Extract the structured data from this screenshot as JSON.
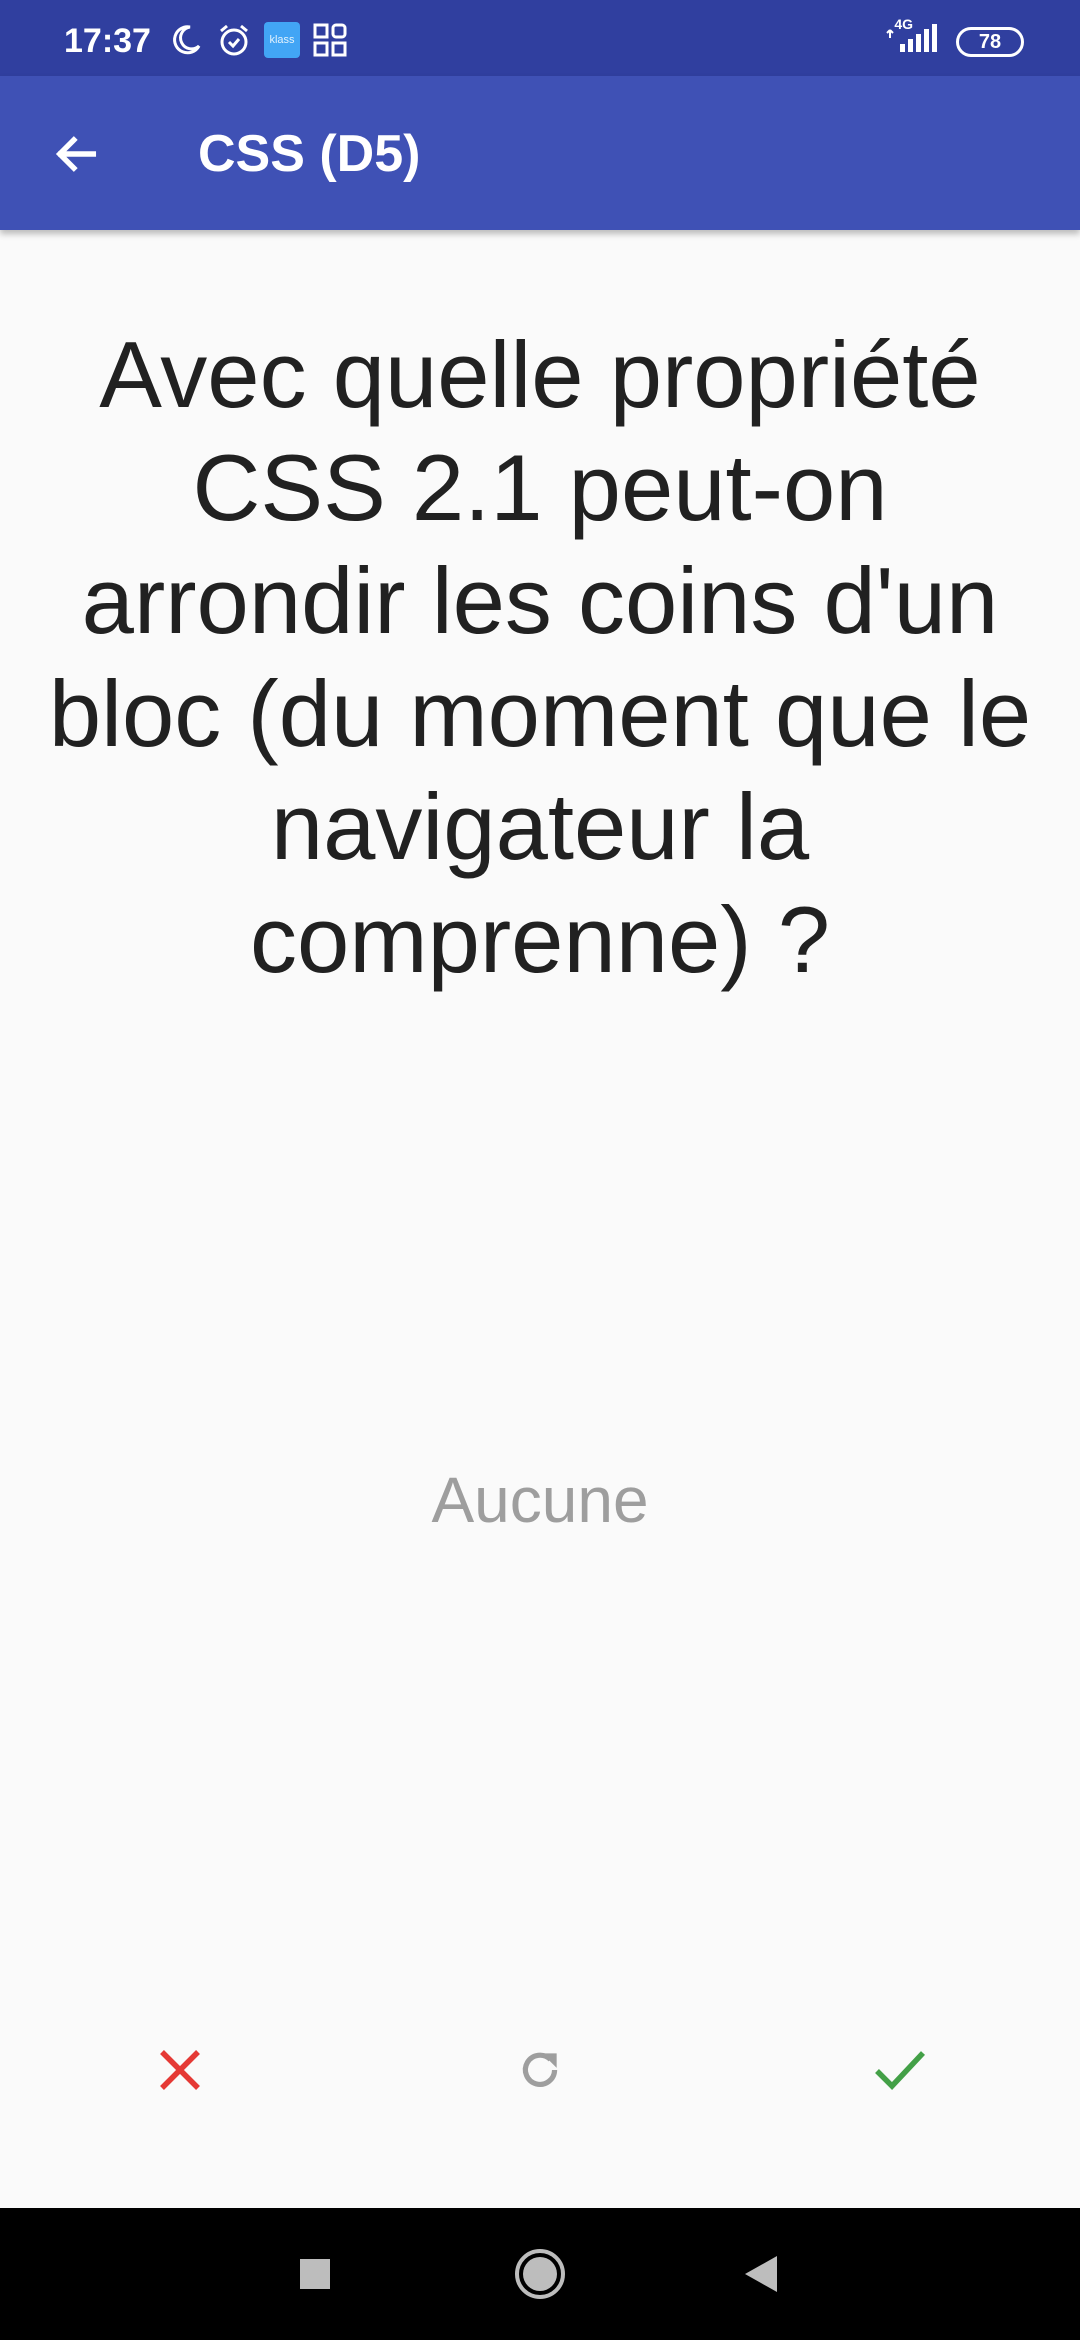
{
  "status_bar": {
    "time": "17:37",
    "left_icons": [
      "moon-icon",
      "alarm-icon",
      "klass-app-icon",
      "grid-app-icon"
    ],
    "klass_label": "klass",
    "network": "4G",
    "battery": "78"
  },
  "app_bar": {
    "title": "CSS (D5)",
    "back_icon": "arrow-back-icon"
  },
  "question": "Avec quelle propriété CSS 2.1 peut-on arrondir les coins d'un bloc (du moment que le navigateur la comprenne) ?",
  "answer": "Aucune",
  "actions": {
    "wrong_icon": "close-icon",
    "retry_icon": "refresh-icon",
    "right_icon": "check-icon"
  },
  "colors": {
    "status_bar": "#303f9f",
    "app_bar": "#3f51b5",
    "wrong": "#e53935",
    "retry": "#9e9e9e",
    "right": "#43a047"
  }
}
